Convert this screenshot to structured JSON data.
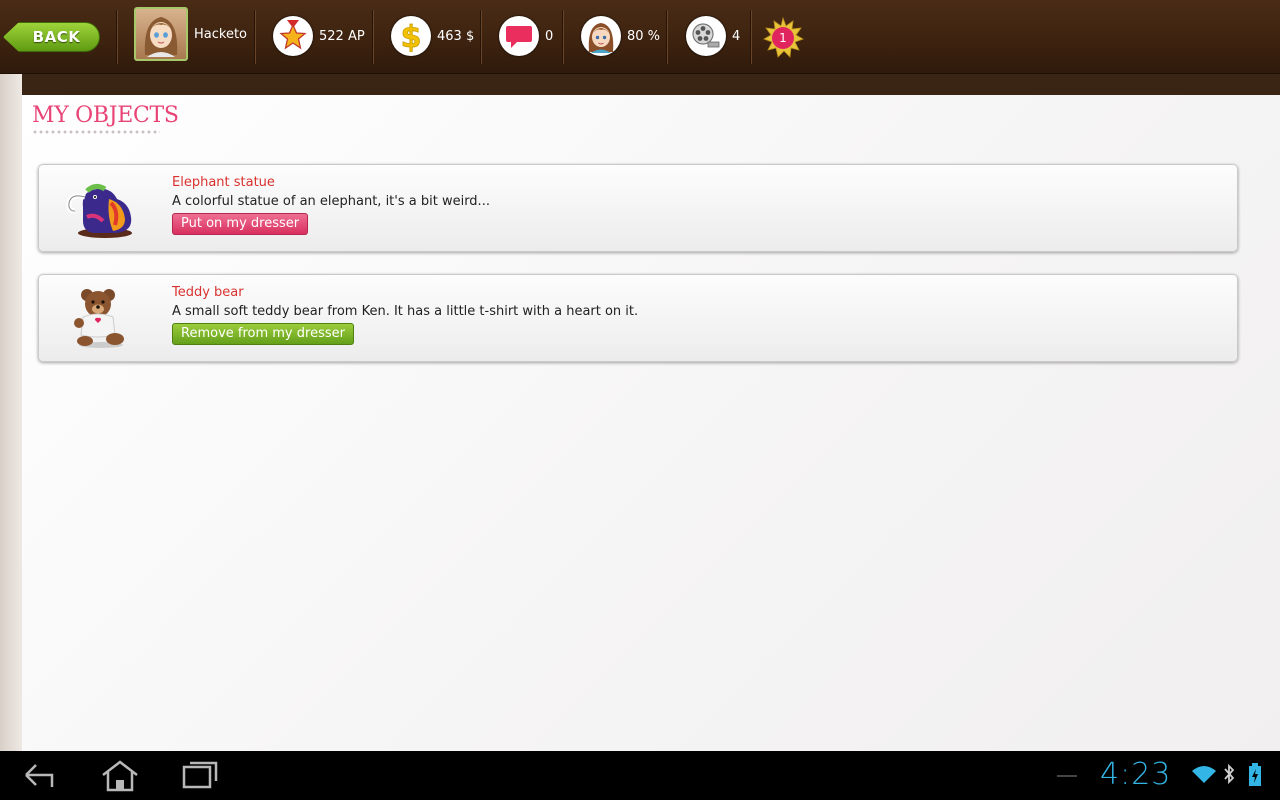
{
  "topbar": {
    "back_label": "BACK",
    "username": "Hacketo",
    "ap": "522 AP",
    "money": "463 $",
    "messages": "0",
    "mood": "80 %",
    "films": "4",
    "notifications": "1"
  },
  "page": {
    "title": "MY OBJECTS"
  },
  "objects": [
    {
      "name": "Elephant statue",
      "description": "A colorful statue of an elephant, it's a bit weird...",
      "action": "Put on my dresser"
    },
    {
      "name": "Teddy bear",
      "description": "A small soft teddy bear from Ken. It has a little t-shirt with a heart on it.",
      "action": "Remove from my dresser"
    }
  ],
  "system": {
    "time": "4:23"
  },
  "colors": {
    "accent": "#e84476",
    "title_red": "#d9322f",
    "clock_blue": "#33b5e5"
  }
}
